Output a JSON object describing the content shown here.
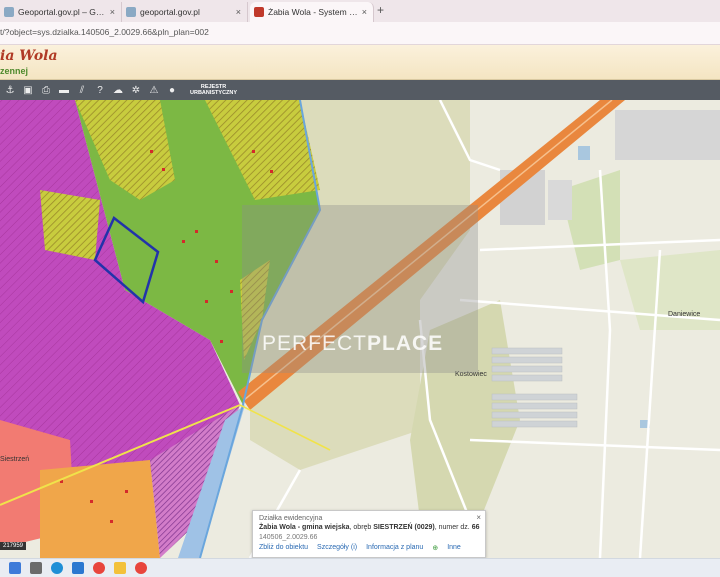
{
  "browser": {
    "tabs": [
      {
        "title": "Geoportal.gov.pl – Geoportal In",
        "active": false
      },
      {
        "title": "geoportal.gov.pl",
        "active": false
      },
      {
        "title": "Żabia Wola - System Informacji",
        "active": true
      }
    ],
    "new_tab": "+",
    "close_glyph": "×",
    "url": "t/?object=sys.dzialka.140506_2.0029.66&pln_plan=002"
  },
  "app": {
    "title": "ia Wola",
    "subtitle": "zennej"
  },
  "toolbar": {
    "icons": [
      "pan-icon",
      "layers-icon",
      "print-icon",
      "car-icon",
      "measure-icon",
      "help-icon",
      "cloud-icon",
      "settings-icon",
      "warning-icon",
      "marker-icon"
    ],
    "rejestr_line1": "REJESTR",
    "rejestr_line2": "URBANISTYCZNY"
  },
  "map": {
    "watermark_left": "PERFECT",
    "watermark_right": "PLACE",
    "places": [
      "Kostowiec",
      "Daniewice",
      "Siestrzeń"
    ],
    "scale_label": "217959"
  },
  "popup": {
    "header": "Działka ewidencyjna",
    "name": "Żabia Wola - gmina wiejska",
    "obreb_prefix": ", obręb ",
    "obreb": "SIESTRZEŃ (0029)",
    "numer_prefix": ", numer dz. ",
    "numer": "66",
    "code": "140506_2.0029.66",
    "links": [
      "Zbliż do obiektu",
      "Szczegóły (i)",
      "Informacja z planu",
      "Inne"
    ],
    "close": "×"
  },
  "colors": {
    "magenta_zone": "#c04bbd",
    "green_zone": "#7cb844",
    "hatched_zone": "#c8cc3e",
    "parcel_highlight": "#2233aa",
    "road_orange": "#e9873e",
    "toolbar": "#555b63"
  },
  "taskbar": {
    "icons": [
      "start-icon",
      "explorer-icon",
      "edge-icon",
      "mail-icon",
      "chrome-icon",
      "files-icon",
      "chrome-icon-2"
    ]
  }
}
